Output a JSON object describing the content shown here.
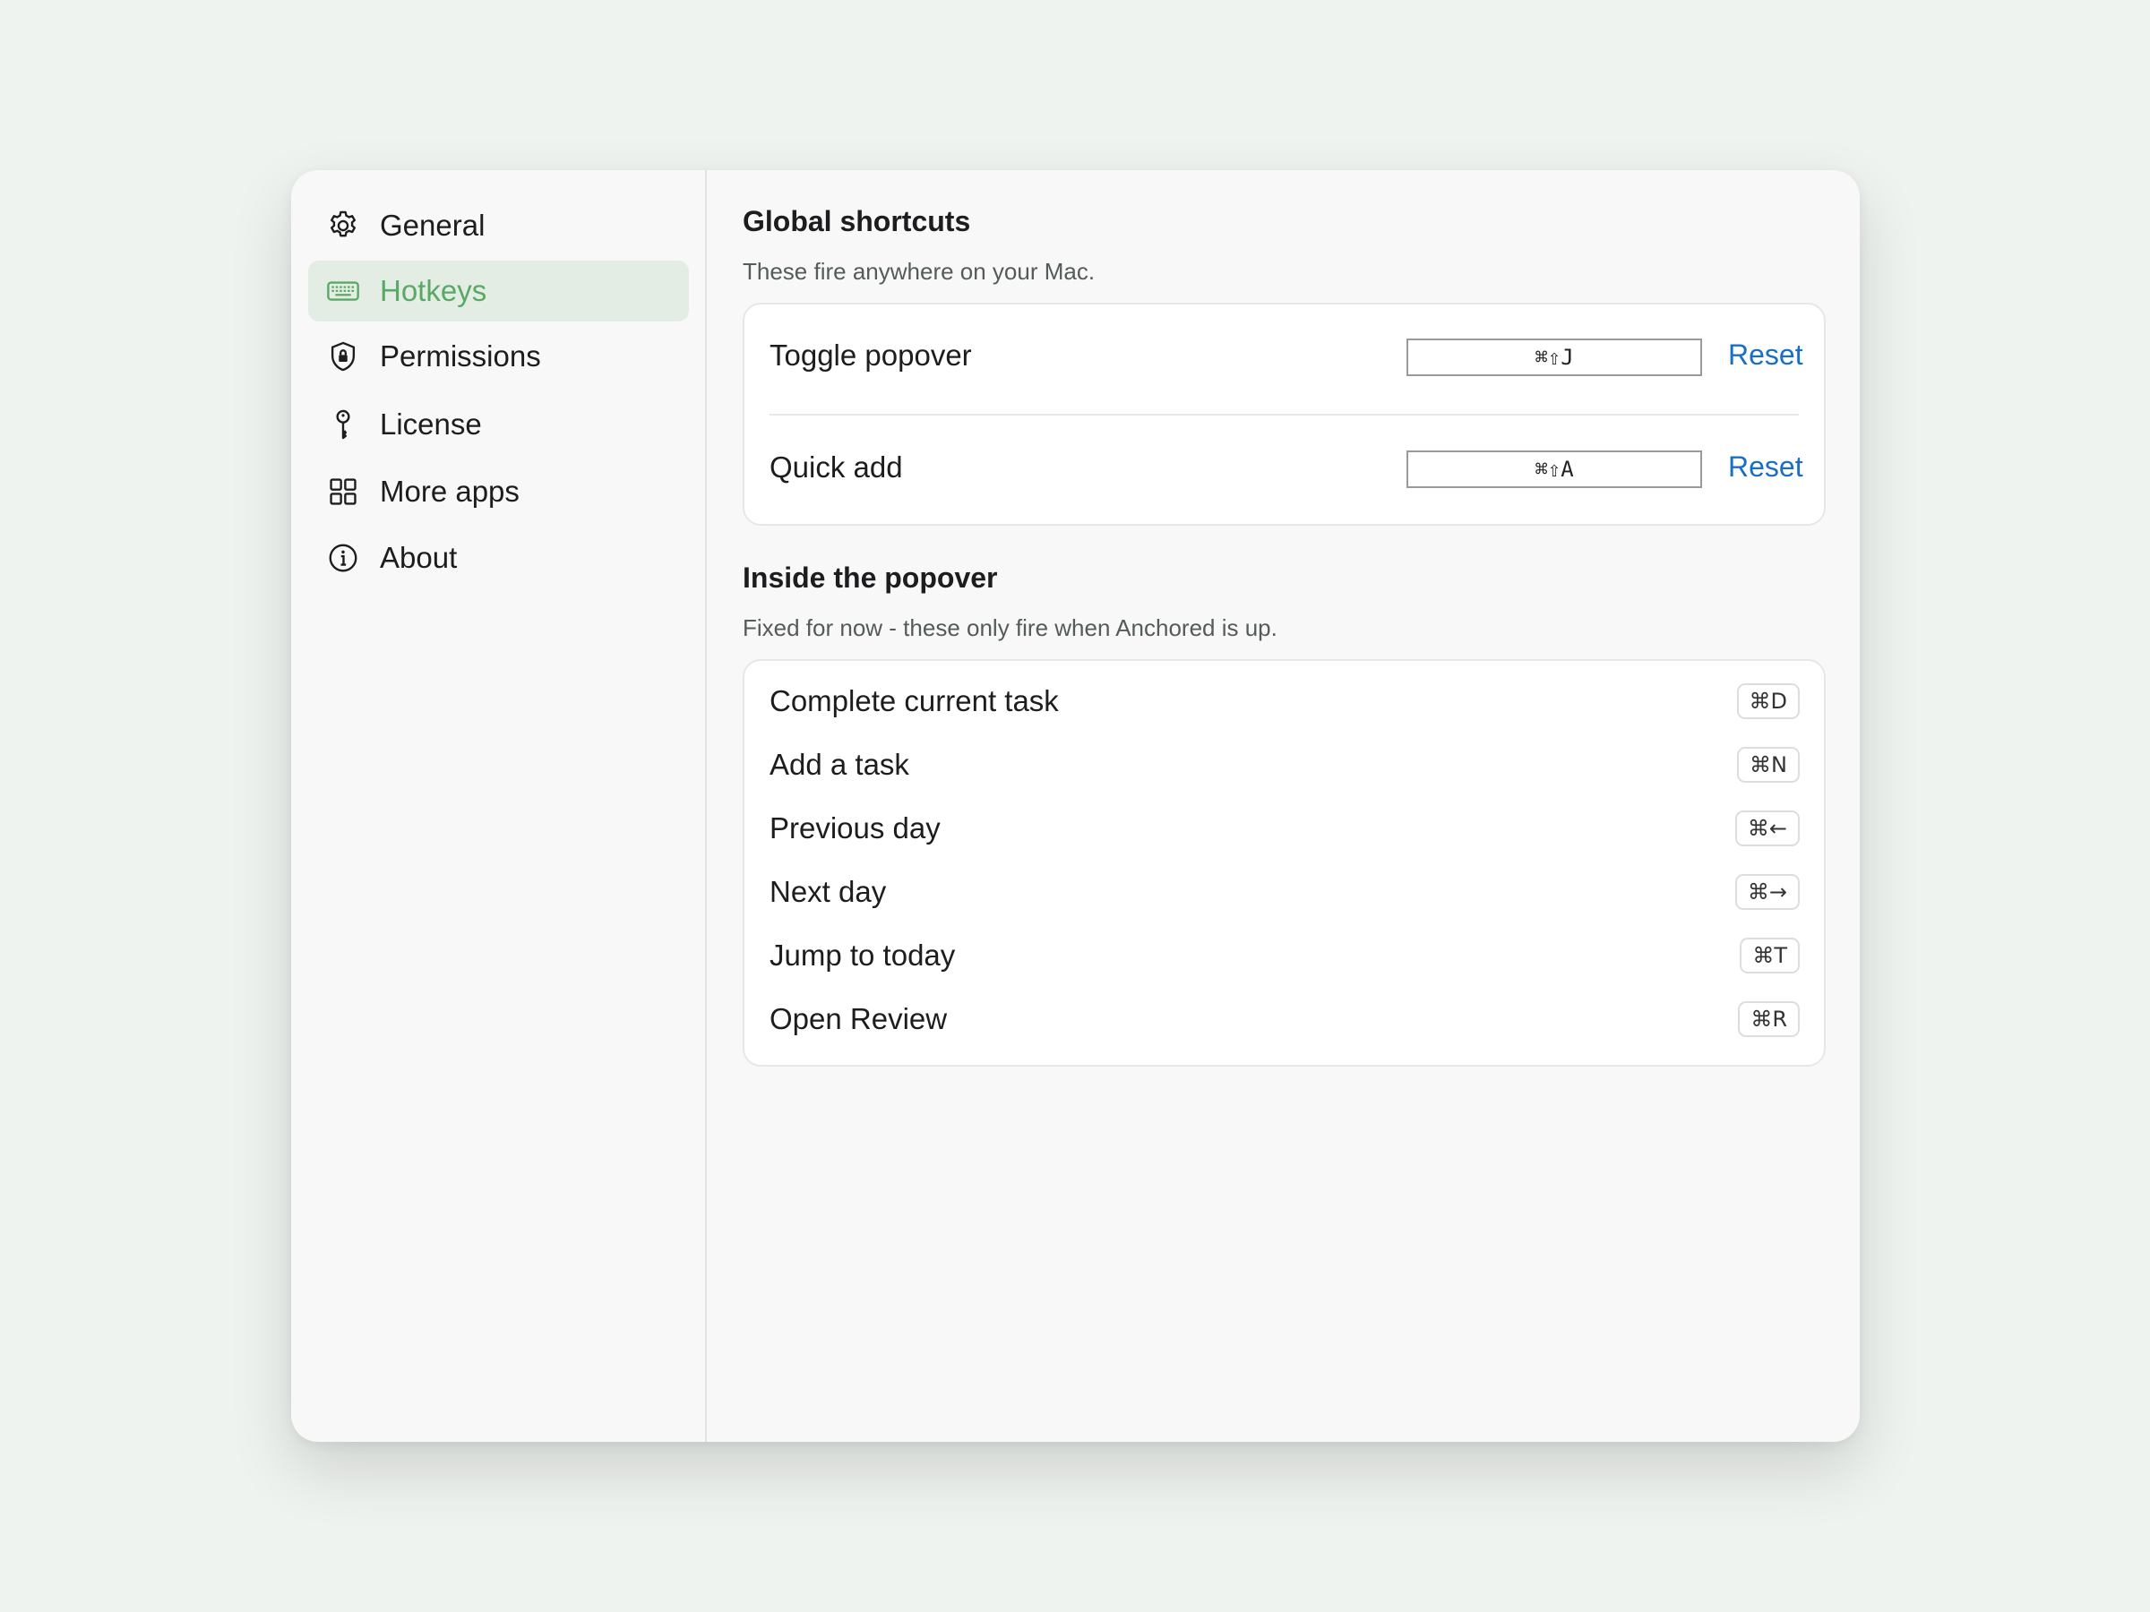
{
  "sidebar": {
    "items": [
      {
        "label": "General",
        "icon": "gear-icon",
        "active": false
      },
      {
        "label": "Hotkeys",
        "icon": "keyboard-icon",
        "active": true
      },
      {
        "label": "Permissions",
        "icon": "shield-lock-icon",
        "active": false
      },
      {
        "label": "License",
        "icon": "key-icon",
        "active": false
      },
      {
        "label": "More apps",
        "icon": "grid-icon",
        "active": false
      },
      {
        "label": "About",
        "icon": "info-icon",
        "active": false
      }
    ]
  },
  "global": {
    "title": "Global shortcuts",
    "subtitle": "These fire anywhere on your Mac.",
    "shortcuts": [
      {
        "label": "Toggle popover",
        "keys": "⌘⇧J",
        "reset": "Reset"
      },
      {
        "label": "Quick add",
        "keys": "⌘⇧A",
        "reset": "Reset"
      }
    ]
  },
  "popover": {
    "title": "Inside the popover",
    "subtitle": "Fixed for now - these only fire when Anchored is up.",
    "shortcuts": [
      {
        "label": "Complete current task",
        "keys": "⌘D"
      },
      {
        "label": "Add a task",
        "keys": "⌘N"
      },
      {
        "label": "Previous day",
        "keys": "⌘←"
      },
      {
        "label": "Next day",
        "keys": "⌘→"
      },
      {
        "label": "Jump to today",
        "keys": "⌘T"
      },
      {
        "label": "Open Review",
        "keys": "⌘R"
      }
    ]
  },
  "colors": {
    "accent": "#5aa865",
    "active_bg": "#e4ede4",
    "link": "#1a6fc4",
    "background": "#eff3ef"
  }
}
